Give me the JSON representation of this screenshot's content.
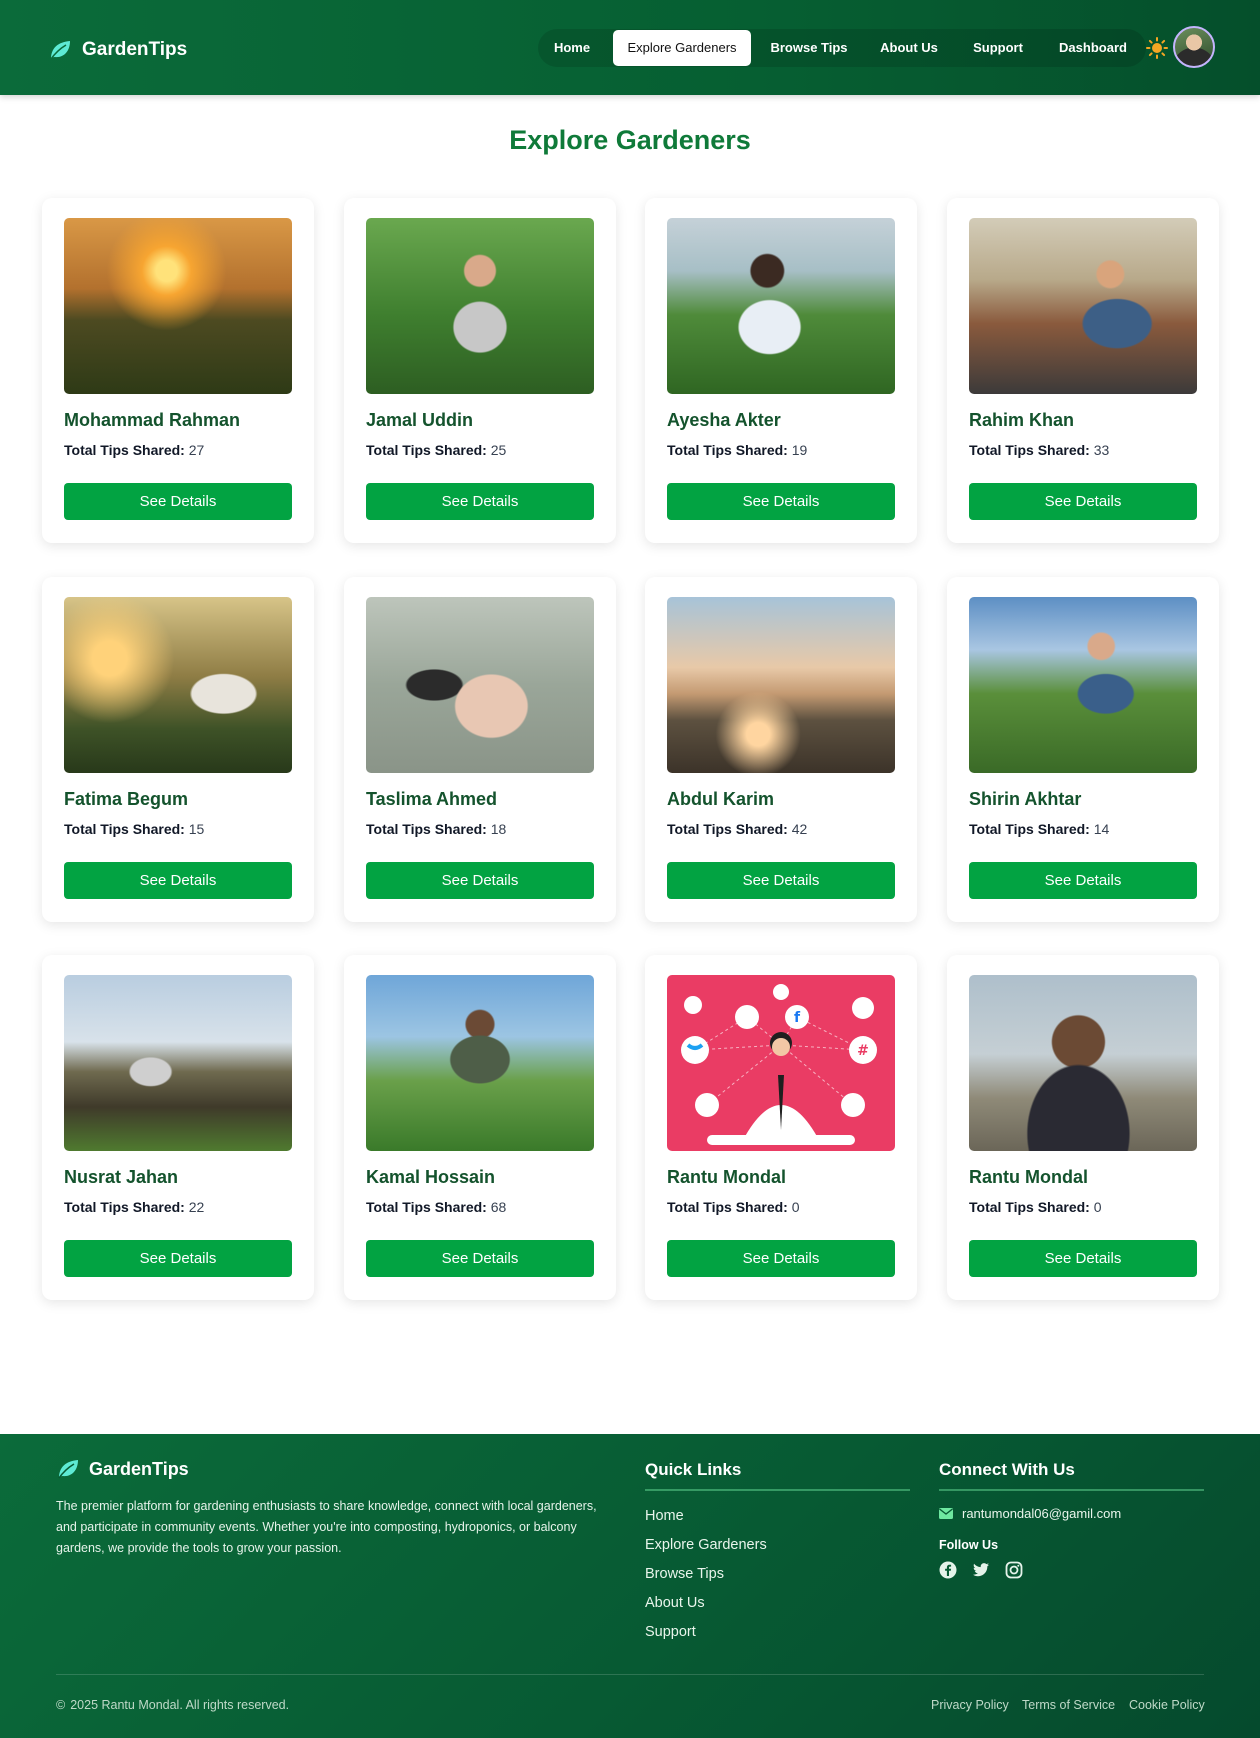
{
  "colors": {
    "nav_bg": "#065f32",
    "accent": "#02a342",
    "title": "#0f7a39",
    "name": "#14532d"
  },
  "brand": {
    "name": "GardenTips",
    "icon": "leaf-icon"
  },
  "nav": {
    "items": [
      {
        "label": "Home",
        "active": false
      },
      {
        "label": "Explore Gardeners",
        "active": true
      },
      {
        "label": "Browse Tips",
        "active": false
      },
      {
        "label": "About Us",
        "active": false
      },
      {
        "label": "Support",
        "active": false
      },
      {
        "label": "Dashboard",
        "active": false
      }
    ],
    "theme_icon": "sun-icon"
  },
  "page": {
    "title": "Explore Gardeners"
  },
  "tips_label": "Total Tips Shared:",
  "button_label": "See Details",
  "gardeners": [
    {
      "name": "Mohammad Rahman",
      "tips": "27"
    },
    {
      "name": "Jamal Uddin",
      "tips": "25"
    },
    {
      "name": "Ayesha Akter",
      "tips": "19"
    },
    {
      "name": "Rahim Khan",
      "tips": "33"
    },
    {
      "name": "Fatima Begum",
      "tips": "15"
    },
    {
      "name": "Taslima Ahmed",
      "tips": "18"
    },
    {
      "name": "Abdul Karim",
      "tips": "42"
    },
    {
      "name": "Shirin Akhtar",
      "tips": "14"
    },
    {
      "name": "Nusrat Jahan",
      "tips": "22"
    },
    {
      "name": "Kamal Hossain",
      "tips": "68"
    },
    {
      "name": "Rantu Mondal",
      "tips": "0"
    },
    {
      "name": "Rantu Mondal",
      "tips": "0"
    }
  ],
  "footer": {
    "brand": "GardenTips",
    "description": "The premier platform for gardening enthusiasts to share knowledge, connect with local gardeners, and participate in community events. Whether you're into composting, hydroponics, or balcony gardens, we provide the tools to grow your passion.",
    "quick_links_title": "Quick Links",
    "quick_links": [
      "Home",
      "Explore Gardeners",
      "Browse Tips",
      "About Us",
      "Support"
    ],
    "connect_title": "Connect With Us",
    "email": "rantumondal06@gamil.com",
    "follow_us": "Follow Us",
    "social_icons": [
      "facebook-icon",
      "twitter-icon",
      "instagram-icon"
    ],
    "copyright": "2025 Rantu Mondal. All rights reserved.",
    "legal_links": [
      "Privacy Policy",
      "Terms of Service",
      "Cookie Policy"
    ]
  }
}
